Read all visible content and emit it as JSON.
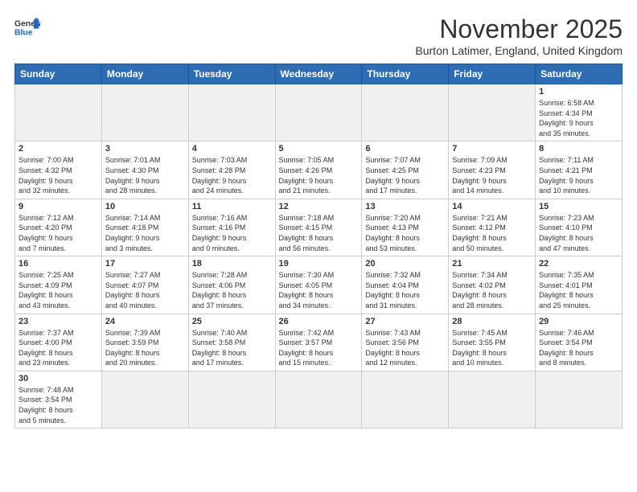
{
  "header": {
    "logo_general": "General",
    "logo_blue": "Blue",
    "month_title": "November 2025",
    "location": "Burton Latimer, England, United Kingdom"
  },
  "weekdays": [
    "Sunday",
    "Monday",
    "Tuesday",
    "Wednesday",
    "Thursday",
    "Friday",
    "Saturday"
  ],
  "weeks": [
    [
      {
        "day": "",
        "info": ""
      },
      {
        "day": "",
        "info": ""
      },
      {
        "day": "",
        "info": ""
      },
      {
        "day": "",
        "info": ""
      },
      {
        "day": "",
        "info": ""
      },
      {
        "day": "",
        "info": ""
      },
      {
        "day": "1",
        "info": "Sunrise: 6:58 AM\nSunset: 4:34 PM\nDaylight: 9 hours\nand 35 minutes."
      }
    ],
    [
      {
        "day": "2",
        "info": "Sunrise: 7:00 AM\nSunset: 4:32 PM\nDaylight: 9 hours\nand 32 minutes."
      },
      {
        "day": "3",
        "info": "Sunrise: 7:01 AM\nSunset: 4:30 PM\nDaylight: 9 hours\nand 28 minutes."
      },
      {
        "day": "4",
        "info": "Sunrise: 7:03 AM\nSunset: 4:28 PM\nDaylight: 9 hours\nand 24 minutes."
      },
      {
        "day": "5",
        "info": "Sunrise: 7:05 AM\nSunset: 4:26 PM\nDaylight: 9 hours\nand 21 minutes."
      },
      {
        "day": "6",
        "info": "Sunrise: 7:07 AM\nSunset: 4:25 PM\nDaylight: 9 hours\nand 17 minutes."
      },
      {
        "day": "7",
        "info": "Sunrise: 7:09 AM\nSunset: 4:23 PM\nDaylight: 9 hours\nand 14 minutes."
      },
      {
        "day": "8",
        "info": "Sunrise: 7:11 AM\nSunset: 4:21 PM\nDaylight: 9 hours\nand 10 minutes."
      }
    ],
    [
      {
        "day": "9",
        "info": "Sunrise: 7:12 AM\nSunset: 4:20 PM\nDaylight: 9 hours\nand 7 minutes."
      },
      {
        "day": "10",
        "info": "Sunrise: 7:14 AM\nSunset: 4:18 PM\nDaylight: 9 hours\nand 3 minutes."
      },
      {
        "day": "11",
        "info": "Sunrise: 7:16 AM\nSunset: 4:16 PM\nDaylight: 9 hours\nand 0 minutes."
      },
      {
        "day": "12",
        "info": "Sunrise: 7:18 AM\nSunset: 4:15 PM\nDaylight: 8 hours\nand 56 minutes."
      },
      {
        "day": "13",
        "info": "Sunrise: 7:20 AM\nSunset: 4:13 PM\nDaylight: 8 hours\nand 53 minutes."
      },
      {
        "day": "14",
        "info": "Sunrise: 7:21 AM\nSunset: 4:12 PM\nDaylight: 8 hours\nand 50 minutes."
      },
      {
        "day": "15",
        "info": "Sunrise: 7:23 AM\nSunset: 4:10 PM\nDaylight: 8 hours\nand 47 minutes."
      }
    ],
    [
      {
        "day": "16",
        "info": "Sunrise: 7:25 AM\nSunset: 4:09 PM\nDaylight: 8 hours\nand 43 minutes."
      },
      {
        "day": "17",
        "info": "Sunrise: 7:27 AM\nSunset: 4:07 PM\nDaylight: 8 hours\nand 40 minutes."
      },
      {
        "day": "18",
        "info": "Sunrise: 7:28 AM\nSunset: 4:06 PM\nDaylight: 8 hours\nand 37 minutes."
      },
      {
        "day": "19",
        "info": "Sunrise: 7:30 AM\nSunset: 4:05 PM\nDaylight: 8 hours\nand 34 minutes."
      },
      {
        "day": "20",
        "info": "Sunrise: 7:32 AM\nSunset: 4:04 PM\nDaylight: 8 hours\nand 31 minutes."
      },
      {
        "day": "21",
        "info": "Sunrise: 7:34 AM\nSunset: 4:02 PM\nDaylight: 8 hours\nand 28 minutes."
      },
      {
        "day": "22",
        "info": "Sunrise: 7:35 AM\nSunset: 4:01 PM\nDaylight: 8 hours\nand 25 minutes."
      }
    ],
    [
      {
        "day": "23",
        "info": "Sunrise: 7:37 AM\nSunset: 4:00 PM\nDaylight: 8 hours\nand 23 minutes."
      },
      {
        "day": "24",
        "info": "Sunrise: 7:39 AM\nSunset: 3:59 PM\nDaylight: 8 hours\nand 20 minutes."
      },
      {
        "day": "25",
        "info": "Sunrise: 7:40 AM\nSunset: 3:58 PM\nDaylight: 8 hours\nand 17 minutes."
      },
      {
        "day": "26",
        "info": "Sunrise: 7:42 AM\nSunset: 3:57 PM\nDaylight: 8 hours\nand 15 minutes."
      },
      {
        "day": "27",
        "info": "Sunrise: 7:43 AM\nSunset: 3:56 PM\nDaylight: 8 hours\nand 12 minutes."
      },
      {
        "day": "28",
        "info": "Sunrise: 7:45 AM\nSunset: 3:55 PM\nDaylight: 8 hours\nand 10 minutes."
      },
      {
        "day": "29",
        "info": "Sunrise: 7:46 AM\nSunset: 3:54 PM\nDaylight: 8 hours\nand 8 minutes."
      }
    ],
    [
      {
        "day": "30",
        "info": "Sunrise: 7:48 AM\nSunset: 3:54 PM\nDaylight: 8 hours\nand 5 minutes."
      },
      {
        "day": "",
        "info": ""
      },
      {
        "day": "",
        "info": ""
      },
      {
        "day": "",
        "info": ""
      },
      {
        "day": "",
        "info": ""
      },
      {
        "day": "",
        "info": ""
      },
      {
        "day": "",
        "info": ""
      }
    ]
  ]
}
